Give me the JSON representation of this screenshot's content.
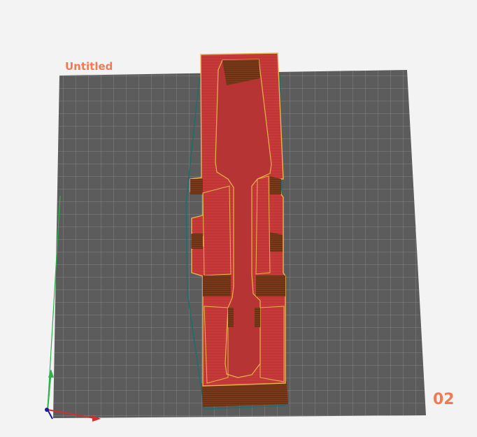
{
  "plate": {
    "title": "Untitled",
    "number": "02"
  },
  "colors": {
    "background": "#f3f3f3",
    "build_plate": "#5c5c5c",
    "grid_lines": "#8a8a8a",
    "model_fill": "#c73a3a",
    "model_wall": "#7a3a1a",
    "perimeter_outline": "#e8b44a",
    "skirt": "#1f6e6a",
    "plate_label": "#f07a54",
    "axis_x": "#d03030",
    "axis_y": "#2cb34a",
    "axis_z": "#1a1a99"
  },
  "icons": {
    "axes_gizmo": "xyz-axes-icon"
  }
}
